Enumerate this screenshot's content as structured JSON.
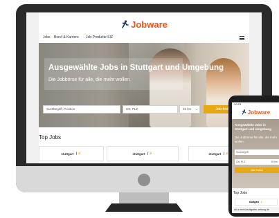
{
  "brand": {
    "name": "Jobware",
    "color": "#e8561d",
    "icon": "running-person-icon"
  },
  "nav": {
    "items": [
      "Jobs",
      "Beruf & Karriere",
      "Job-Produkte SIZ"
    ],
    "menu_icon": "hamburger-menu-icon"
  },
  "hero": {
    "headline": "Ausgewählte Jobs in Stuttgart und Umgebung",
    "subline": "Die Jobbörse für alle, die mehr wollen."
  },
  "search": {
    "keyword_placeholder": "Suchbegriff, Position",
    "location_placeholder": "Ort, PLZ",
    "radius_value": "25 km",
    "button_label": "Job finden",
    "button_color": "#e6a914"
  },
  "top_jobs": {
    "heading": "Top Jobs",
    "tiles": [
      "stuttgart",
      "stuttgart",
      "stuttgart"
    ]
  },
  "phone": {
    "time": "10:23",
    "headline": "Ausgewählte Jobs in Stuttgart und Umgebung",
    "subline": "Die Jobbörse für alle, die mehr wollen.",
    "keyword_placeholder": "Suchbegriff",
    "location_placeholder": "Ort, PLZ",
    "radius_value": "25 km",
    "button_label": "Job finden",
    "top_heading": "Top Jobs",
    "tile": "stuttgart",
    "url": "aA  ● meinl-stuttgarter-zeitung.de"
  }
}
